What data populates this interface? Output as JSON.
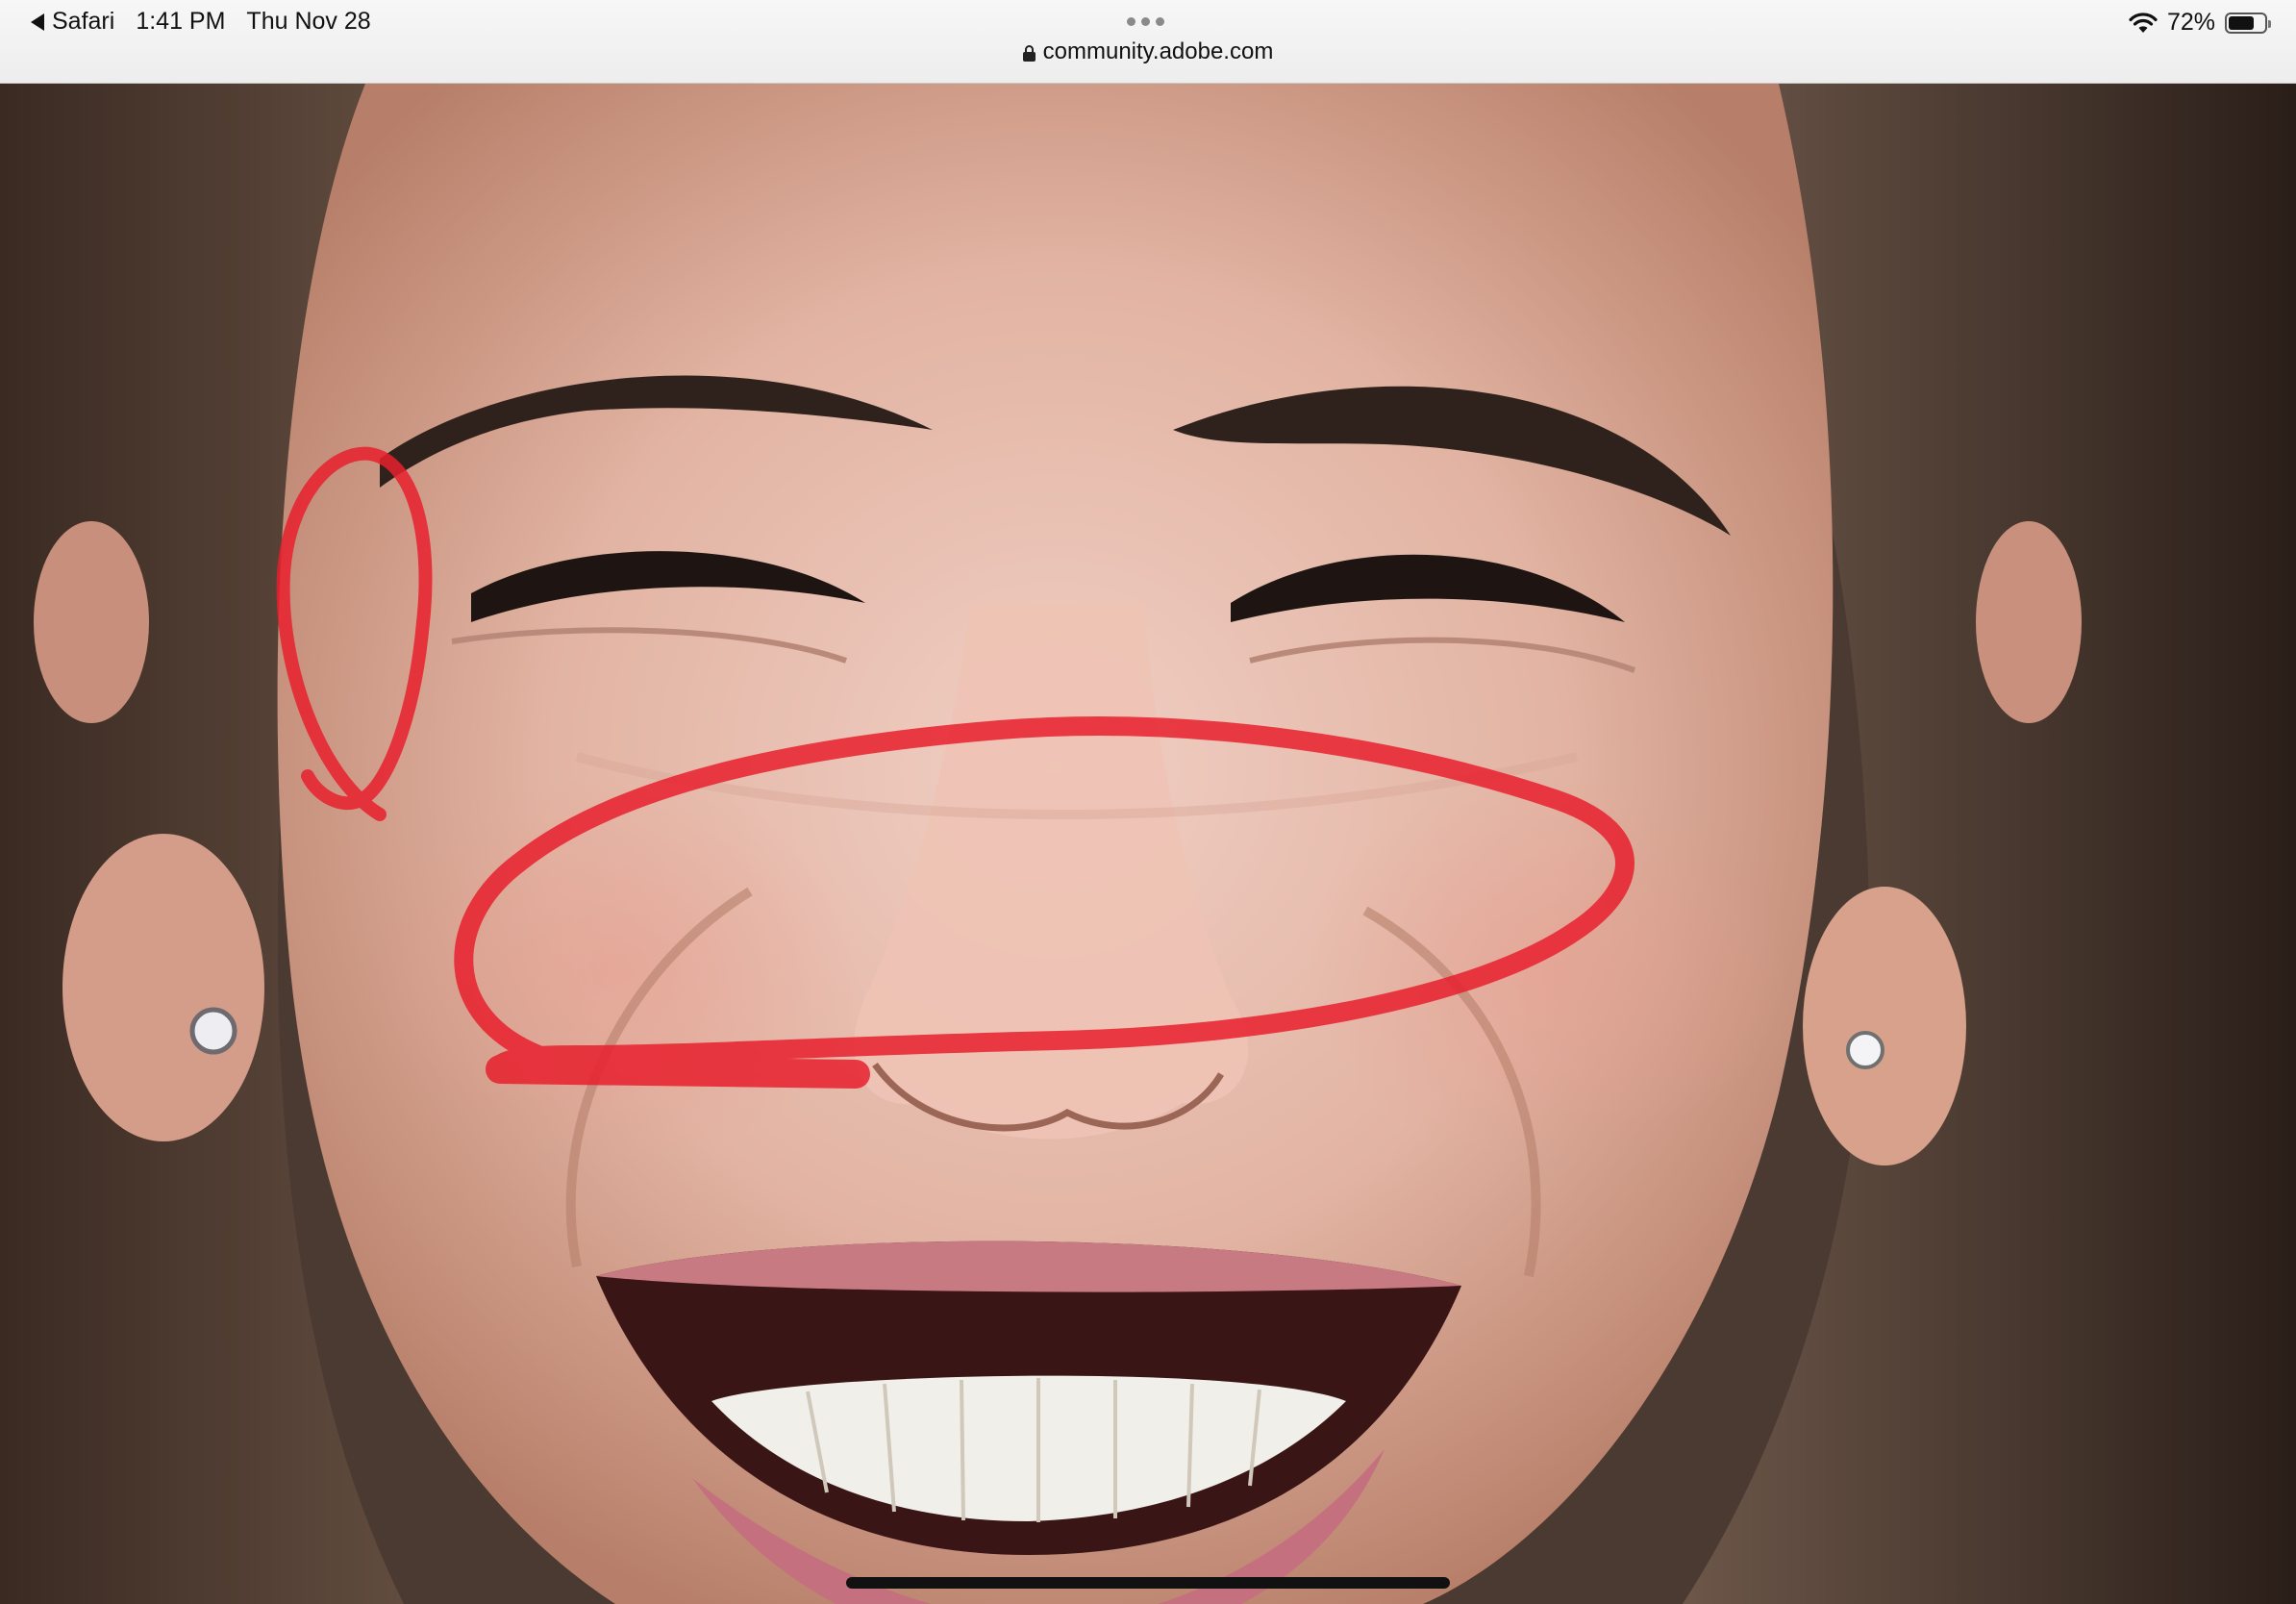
{
  "status_bar": {
    "back_label": "Safari",
    "time": "1:41 PM",
    "date": "Thu Nov 28",
    "battery_percent": "72%",
    "battery_level": 0.72,
    "url": "community.adobe.com"
  },
  "content": {
    "image_subject": "close-up photo of a smiling woman's face with red marker annotations",
    "annotation_color": "#e8202e"
  }
}
